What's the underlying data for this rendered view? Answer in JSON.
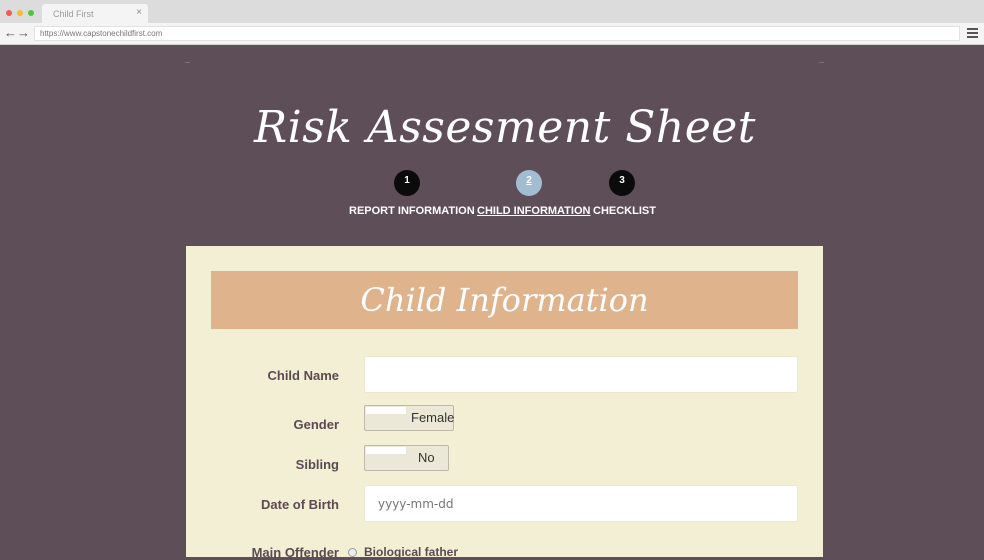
{
  "browser": {
    "tab_title": "Child First",
    "tab_close": "×",
    "url": "https://www.capstonechildfirst.com",
    "back_icon": "arrow-left-icon",
    "forward_icon": "arrow-right-icon",
    "menu_icon": "hamburger-menu-icon"
  },
  "page": {
    "title": "Risk Assesment Sheet"
  },
  "steps": [
    {
      "number": "1",
      "label": "REPORT INFORMATION",
      "active": false
    },
    {
      "number": "2",
      "label": "CHILD INFORMATION",
      "active": true
    },
    {
      "number": "3",
      "label": "CHECKLIST",
      "active": false
    }
  ],
  "form": {
    "section_title": "Child Information",
    "child_name": {
      "label": "Child Name",
      "value": ""
    },
    "gender": {
      "label": "Gender",
      "value": "Female"
    },
    "sibling": {
      "label": "Sibling",
      "value": "No"
    },
    "dob": {
      "label": "Date of Birth",
      "placeholder": "yyyy-mm-dd"
    },
    "main_offender": {
      "label": "Main Offender",
      "option_1": "Biological father"
    }
  },
  "colors": {
    "background": "#5e4e57",
    "card": "#f3efd4",
    "banner": "#dfb38c",
    "step_active": "#a2bdd2",
    "step_inactive": "#0b0b0b"
  }
}
